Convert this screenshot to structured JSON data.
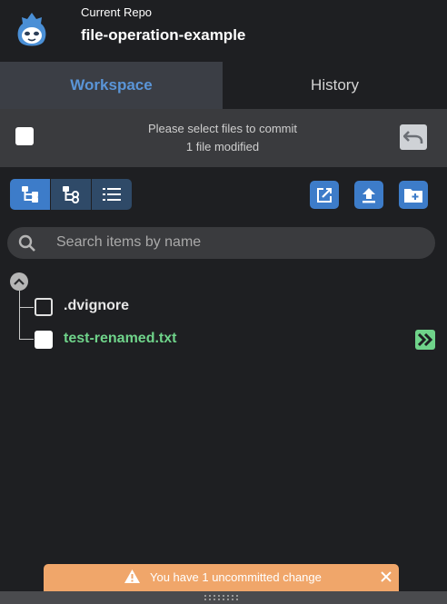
{
  "header": {
    "caption": "Current Repo",
    "repo_name": "file-operation-example"
  },
  "tabs": [
    {
      "label": "Workspace",
      "active": true
    },
    {
      "label": "History",
      "active": false
    }
  ],
  "commit_bar": {
    "prompt": "Please select files to commit",
    "modified_count": "1 file modified"
  },
  "toolbar": {
    "view_modes": [
      "tree-icon",
      "tree-selected-icon",
      "list-icon"
    ],
    "actions": [
      "open-external-icon",
      "upload-icon",
      "new-folder-icon"
    ]
  },
  "search": {
    "placeholder": "Search items by name"
  },
  "files": [
    {
      "name": ".dvignore",
      "modified": false
    },
    {
      "name": "test-renamed.txt",
      "modified": true,
      "status": "renamed"
    }
  ],
  "toast": {
    "message": "You have 1 uncommitted change"
  },
  "colors": {
    "accent": "#3d7cc9",
    "modified": "#6fd38a",
    "toast": "#f0a66a"
  }
}
